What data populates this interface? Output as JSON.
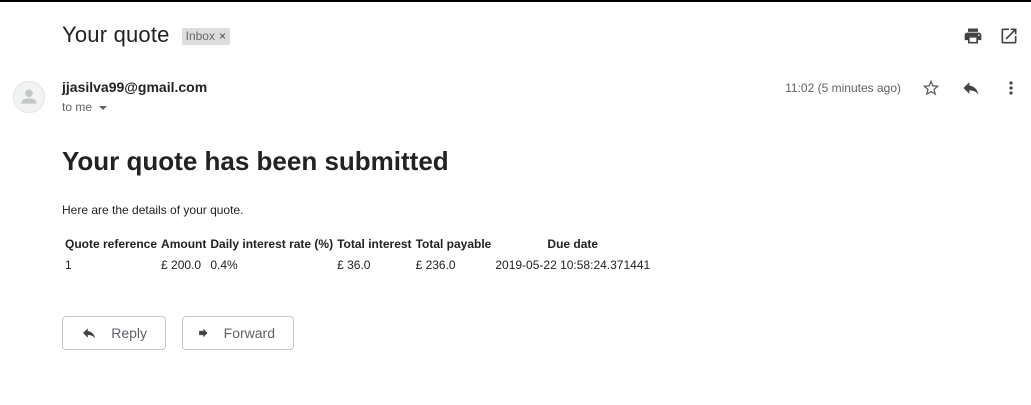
{
  "email": {
    "subject": "Your quote",
    "label": "Inbox",
    "label_remove": "×",
    "sender": "jjasilva99@gmail.com",
    "recipients": "to me",
    "timestamp": "11:02 (5 minutes ago)"
  },
  "icons": {
    "print": "print-icon",
    "open_new": "open-in-new-icon",
    "star": "star-icon",
    "reply": "reply-icon",
    "more": "more-vert-icon",
    "forward": "forward-icon",
    "avatar": "person-icon"
  },
  "body": {
    "heading": "Your quote has been submitted",
    "intro": "Here are the details of your quote.",
    "table": {
      "headers": [
        "Quote reference",
        "Amount",
        "Daily interest rate (%)",
        "Total interest",
        "Total payable",
        "Due date"
      ],
      "rows": [
        [
          "1",
          "£ 200.0",
          "0.4%",
          "£ 36.0",
          "£ 236.0",
          "2019-05-22 10:58:24.371441"
        ]
      ]
    }
  },
  "actions": {
    "reply": "Reply",
    "forward": "Forward"
  }
}
